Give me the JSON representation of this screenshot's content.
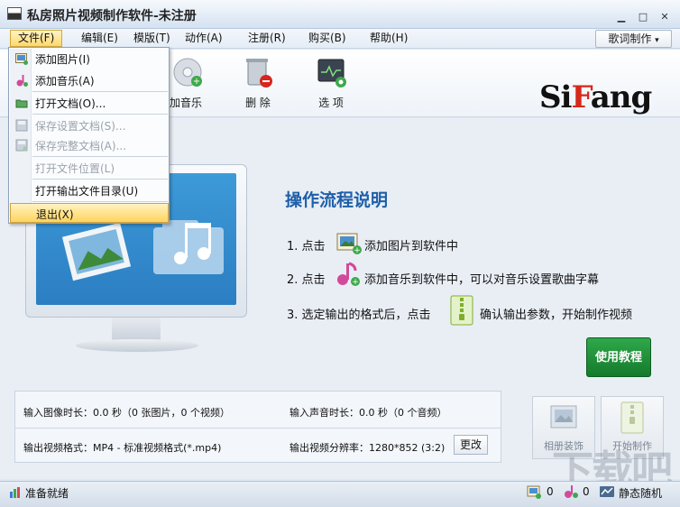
{
  "window": {
    "title": "私房照片视频制作软件-未注册",
    "minimize": "▁",
    "maximize": "□",
    "close": "✕"
  },
  "menubar": {
    "items": [
      "文件(F)",
      "编辑(E)",
      "模版(T)",
      "动作(A)",
      "注册(R)",
      "购买(B)",
      "帮助(H)"
    ],
    "lyric_button": "歌词制作",
    "lyric_arrow": "▾"
  },
  "toolbar": {
    "add_music_label": "加音乐",
    "delete_label": "删 除",
    "options_label": "选 项"
  },
  "logo": {
    "prefix": "Si",
    "accent": "F",
    "suffix": "ang"
  },
  "file_menu": {
    "items": [
      {
        "label": "添加图片(I)",
        "icon": "add-image-icon",
        "enabled": true
      },
      {
        "label": "添加音乐(A)",
        "icon": "add-music-icon",
        "enabled": true
      },
      {
        "label": "打开文档(O)...",
        "icon": "open-folder-icon",
        "enabled": true
      },
      {
        "label": "保存设置文档(S)...",
        "icon": "save-icon",
        "enabled": false
      },
      {
        "label": "保存完整文档(A)...",
        "icon": "save-all-icon",
        "enabled": false
      },
      {
        "label": "打开文件位置(L)",
        "icon": "",
        "enabled": false
      },
      {
        "label": "打开输出文件目录(U)",
        "icon": "",
        "enabled": true
      },
      {
        "label": "退出(X)",
        "icon": "",
        "enabled": true,
        "selected": true
      }
    ]
  },
  "flow": {
    "title": "操作流程说明",
    "step1_prefix": "1. 点击",
    "step1_suffix": "添加图片到软件中",
    "step2_prefix": "2. 点击",
    "step2_suffix": "添加音乐到软件中，可以对音乐设置歌曲字幕",
    "step3_prefix": "3. 选定输出的格式后，点击",
    "step3_suffix": "确认输出参数，开始制作视频",
    "tutorial_button": "使用教程"
  },
  "info": {
    "image_duration": "输入图像时长：0.0 秒（0 张图片，0 个视频）",
    "audio_duration": "输入声音时长：0.0 秒（0 个音频）",
    "output_format": "输出视频格式：MP4 - 标准视频格式(*.mp4)",
    "output_resolution": "输出视频分辨率：1280*852 (3:2)",
    "change_button": "更改"
  },
  "actions": {
    "album_decor": "相册装饰",
    "start_make": "开始制作"
  },
  "status": {
    "ready": "准备就绪",
    "image_count": "0",
    "music_count": "0",
    "mode": "静态随机"
  },
  "watermark": "下载吧",
  "colors": {
    "accent_blue": "#1e5fa8",
    "tutorial_green": "#1f8f3a",
    "menu_highlight": "#ffd86b",
    "logo_red": "#d6281d"
  }
}
